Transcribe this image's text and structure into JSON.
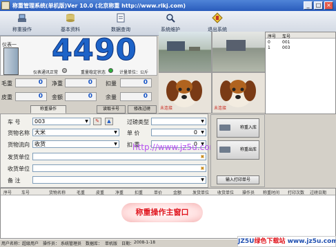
{
  "window": {
    "title": "称重管理系统(单机版)Ver 10.0 (北京称重 http://www.rlkj.com)"
  },
  "toolbar": [
    {
      "label": "称重操作",
      "icon": "scale-icon"
    },
    {
      "label": "基本资料",
      "icon": "database-icon"
    },
    {
      "label": "数据查询",
      "icon": "report-icon"
    },
    {
      "label": "系统维护",
      "icon": "magnifier-icon"
    },
    {
      "label": "退出系统",
      "icon": "exit-icon"
    }
  ],
  "weight": {
    "value": "4490",
    "label_top": "仪表一",
    "status1": "仪表通讯正常",
    "status2": "重量稳定状态",
    "status3": "计量单位：公斤"
  },
  "summary": [
    {
      "label": "毛重",
      "value": "0"
    },
    {
      "label": "净重",
      "value": "0"
    },
    {
      "label": "扣量",
      "value": "0"
    },
    {
      "label": "皮重",
      "value": "0"
    },
    {
      "label": "金额",
      "value": "0"
    },
    {
      "label": "余量",
      "value": "0"
    }
  ],
  "tabs": [
    "称重操作",
    "读取卡号",
    "修改过磅"
  ],
  "form": {
    "car_label": "车  号",
    "car_value": "003",
    "goods_label": "货物名称",
    "goods_value": "大米",
    "flow_label": "货物流向",
    "flow_value": "收货",
    "sender_label": "发货单位",
    "receiver_label": "收货单位",
    "remark_label": "备  注",
    "weigh_type_label": "过磅类型",
    "unit_price_label": "单  价",
    "unit_price_value": "0",
    "deduct_label": "扣  重",
    "deduct_value": "0"
  },
  "buttons": {
    "weigh_in": "称重入库",
    "weigh_out": "称重出库",
    "print": "输入打印单号"
  },
  "watermark": "http://www.jz5u.com",
  "cameras": {
    "cam1_label": "未连接",
    "cam2_label": "未连接"
  },
  "pending": {
    "headers": [
      "序号",
      "车号"
    ],
    "rows": [
      {
        "seq": "0",
        "car": "001"
      },
      {
        "seq": "1",
        "car": "003"
      }
    ]
  },
  "grid": {
    "headers": [
      "序号",
      "车号",
      "货物名称",
      "毛重",
      "皮重",
      "净重",
      "扣重",
      "单价",
      "金额",
      "发货单位",
      "收货单位",
      "操作员",
      "称重时间",
      "打印次数",
      "过磅日期"
    ]
  },
  "banner": "称重操作主窗口",
  "statusbar": {
    "segments": [
      "用户名称：",
      "超级用户",
      "操作员：",
      "系统管理员",
      "数据库：",
      "单机版",
      "日期：",
      "2008-1-18"
    ]
  },
  "logo": {
    "text_a": "JZ5U",
    "text_b": "绿色下载站",
    "text_c": "www.jz5u.com"
  }
}
